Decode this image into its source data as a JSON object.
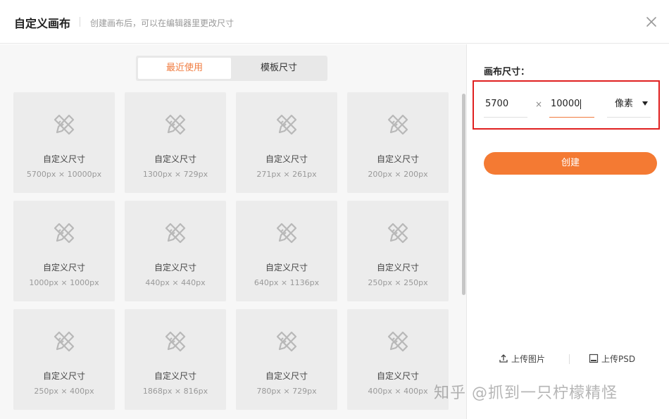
{
  "dialog": {
    "title": "自定义画布",
    "subtitle": "创建画布后，可以在编辑器里更改尺寸",
    "close_icon": "close-icon"
  },
  "tabs": [
    {
      "label": "最近使用",
      "active": true
    },
    {
      "label": "模板尺寸",
      "active": false
    }
  ],
  "cards": [
    {
      "label": "自定义尺寸",
      "size": "5700px × 10000px"
    },
    {
      "label": "自定义尺寸",
      "size": "1300px × 729px"
    },
    {
      "label": "自定义尺寸",
      "size": "271px × 261px"
    },
    {
      "label": "自定义尺寸",
      "size": "200px × 200px"
    },
    {
      "label": "自定义尺寸",
      "size": "1000px × 1000px"
    },
    {
      "label": "自定义尺寸",
      "size": "440px × 440px"
    },
    {
      "label": "自定义尺寸",
      "size": "640px × 1136px"
    },
    {
      "label": "自定义尺寸",
      "size": "250px × 250px"
    },
    {
      "label": "自定义尺寸",
      "size": "250px × 400px"
    },
    {
      "label": "自定义尺寸",
      "size": "1868px × 816px"
    },
    {
      "label": "自定义尺寸",
      "size": "780px × 729px"
    },
    {
      "label": "自定义尺寸",
      "size": "400px × 400px"
    }
  ],
  "panel": {
    "size_label": "画布尺寸：",
    "width_value": "5700",
    "times": "×",
    "height_value": "10000",
    "unit": "像素",
    "create_label": "创建",
    "upload_image_label": "上传图片",
    "upload_psd_label": "上传PSD"
  },
  "watermark": "知乎 @抓到一只柠檬精怪",
  "colors": {
    "accent": "#f47a33",
    "highlight_box": "#e02020",
    "card_bg": "#ececec"
  }
}
